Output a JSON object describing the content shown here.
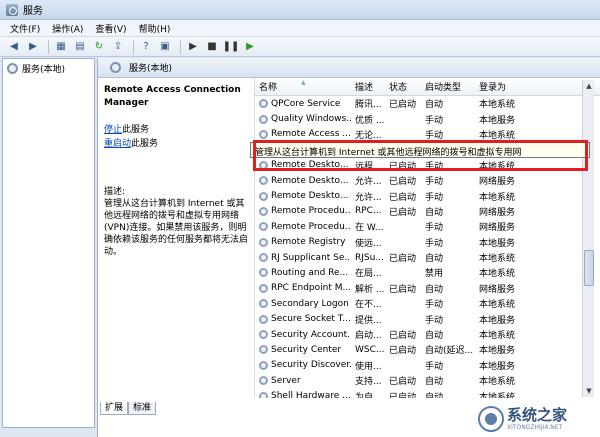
{
  "window": {
    "title": "服务"
  },
  "menu": [
    "文件(F)",
    "操作(A)",
    "查看(V)",
    "帮助(H)"
  ],
  "toolbar": {
    "icons": [
      "back-icon",
      "forward-icon",
      "console-tree-icon",
      "properties-icon",
      "refresh-icon",
      "export-icon",
      "help-icon",
      "show-hide-icon",
      "start-icon",
      "stop-icon",
      "pause-icon",
      "restart-icon"
    ]
  },
  "tree": {
    "root": "服务(本地)"
  },
  "main": {
    "header": "服务(本地)",
    "selected_service": "Remote Access Connection Manager",
    "actions": {
      "stop_link": "停止",
      "stop_suffix": "此服务",
      "restart_link": "重启动",
      "restart_suffix": "此服务"
    },
    "description_label": "描述:",
    "description": "管理从这台计算机到 Internet 或其他远程网络的拨号和虚拟专用网络(VPN)连接。如果禁用该服务，则明确依赖该服务的任何服务都将无法启动。"
  },
  "columns": {
    "name": "名称",
    "desc": "描述",
    "status": "状态",
    "startup": "启动类型",
    "logon": "登录为"
  },
  "rows": [
    {
      "name": "QPCore Service",
      "desc": "腾讯...",
      "status": "已启动",
      "startup": "自动",
      "logon": "本地系统"
    },
    {
      "name": "Quality Windows...",
      "desc": "优质 ...",
      "status": "",
      "startup": "手动",
      "logon": "本地服务"
    },
    {
      "name": "Remote Access ...",
      "desc": "无论...",
      "status": "",
      "startup": "手动",
      "logon": "本地系统"
    },
    {
      "name": "Remote Access ...",
      "desc": "",
      "status": "",
      "startup": "",
      "logon": "",
      "selected": true
    },
    {
      "name": "Remote Deskto...",
      "desc": "远程...",
      "status": "已启动",
      "startup": "手动",
      "logon": "本地系统"
    },
    {
      "name": "Remote Deskto...",
      "desc": "允许...",
      "status": "已启动",
      "startup": "手动",
      "logon": "网络服务"
    },
    {
      "name": "Remote Deskto...",
      "desc": "允许...",
      "status": "已启动",
      "startup": "手动",
      "logon": "本地系统"
    },
    {
      "name": "Remote Procedu...",
      "desc": "RPC...",
      "status": "已启动",
      "startup": "自动",
      "logon": "网络服务"
    },
    {
      "name": "Remote Procedu...",
      "desc": "在 W...",
      "status": "",
      "startup": "手动",
      "logon": "网络服务"
    },
    {
      "name": "Remote Registry",
      "desc": "使远...",
      "status": "",
      "startup": "手动",
      "logon": "本地服务"
    },
    {
      "name": "RJ Supplicant Se...",
      "desc": "RJSu...",
      "status": "已启动",
      "startup": "自动",
      "logon": "本地系统"
    },
    {
      "name": "Routing and Re...",
      "desc": "在局...",
      "status": "",
      "startup": "禁用",
      "logon": "本地系统"
    },
    {
      "name": "RPC Endpoint M...",
      "desc": "解析 ...",
      "status": "已启动",
      "startup": "自动",
      "logon": "网络服务"
    },
    {
      "name": "Secondary Logon",
      "desc": "在不...",
      "status": "",
      "startup": "手动",
      "logon": "本地系统"
    },
    {
      "name": "Secure Socket T...",
      "desc": "提供...",
      "status": "",
      "startup": "手动",
      "logon": "本地服务"
    },
    {
      "name": "Security Account...",
      "desc": "启动...",
      "status": "已启动",
      "startup": "自动",
      "logon": "本地系统"
    },
    {
      "name": "Security Center",
      "desc": "WSC...",
      "status": "已启动",
      "startup": "自动(延迟...",
      "logon": "本地服务"
    },
    {
      "name": "Security Discover...",
      "desc": "使用...",
      "status": "",
      "startup": "手动",
      "logon": "本地服务"
    },
    {
      "name": "Server",
      "desc": "支持...",
      "status": "已启动",
      "startup": "自动",
      "logon": "本地系统"
    },
    {
      "name": "Shell Hardware ...",
      "desc": "为自...",
      "status": "已启动",
      "startup": "自动",
      "logon": "本地系统"
    }
  ],
  "tooltip": "管理从这台计算机到 Internet 或其他远程网络的拨号和虚拟专用网",
  "tabs": [
    "扩展",
    "标准"
  ],
  "watermark": {
    "cn": "系统之家",
    "en": "XITONGZHIJIA.NET"
  },
  "colors": {
    "highlight": "#e02020",
    "link": "#0645c4",
    "selection": "#cfe3fb"
  }
}
